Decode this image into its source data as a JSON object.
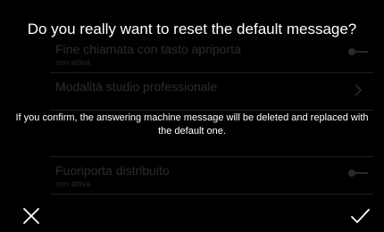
{
  "dialog": {
    "title": "Do you really want to reset the default message?",
    "message": "If you confirm, the answering machine message will be deleted and replaced with the default one.",
    "cancel_icon": "close-icon",
    "confirm_icon": "check-icon"
  },
  "background_settings": {
    "items": [
      {
        "title": "Fine chiamata con tasto apriporta",
        "subtitle": "non attiva",
        "control": "toggle"
      },
      {
        "title": "Modalità studio professionale",
        "subtitle": "",
        "control": "chevron"
      },
      {
        "title": "",
        "subtitle": "",
        "control": "none"
      },
      {
        "title": "Fuoriporta distribuito",
        "subtitle": "non attiva",
        "control": "toggle"
      }
    ]
  },
  "colors": {
    "background": "#000000",
    "text": "#ffffff",
    "dimmed_text": "#2c2c2c"
  }
}
